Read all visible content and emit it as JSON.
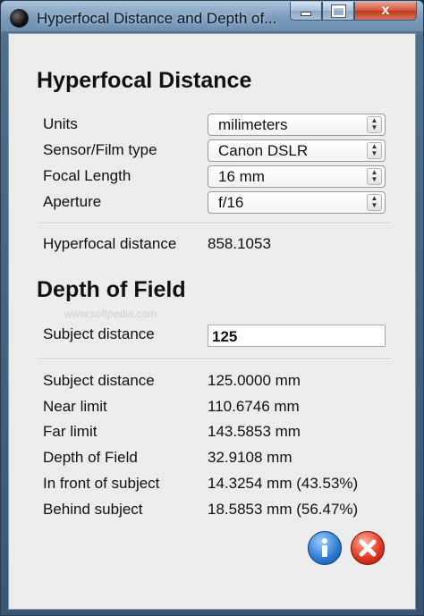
{
  "window": {
    "title": "Hyperfocal Distance and Depth of...",
    "minimize_label": "",
    "maximize_label": "",
    "close_label": "x"
  },
  "hyperfocal": {
    "heading": "Hyperfocal Distance",
    "units": {
      "label": "Units",
      "value": "milimeters"
    },
    "sensor": {
      "label": "Sensor/Film type",
      "value": "Canon DSLR"
    },
    "focal": {
      "label": "Focal Length",
      "value": "16 mm"
    },
    "aperture": {
      "label": "Aperture",
      "value": "f/16"
    },
    "result": {
      "label": "Hyperfocal distance",
      "value": "858.1053"
    }
  },
  "dof": {
    "heading": "Depth of Field",
    "watermark": "www.softpedia.com",
    "subject_input": {
      "label": "Subject distance",
      "value": "125"
    },
    "results": [
      {
        "label": "Subject distance",
        "value": "125.0000 mm"
      },
      {
        "label": "Near limit",
        "value": "110.6746 mm"
      },
      {
        "label": "Far limit",
        "value": "143.5853 mm"
      },
      {
        "label": "Depth of Field",
        "value": "32.9108 mm"
      },
      {
        "label": "In front of subject",
        "value": "14.3254 mm (43.53%)"
      },
      {
        "label": "Behind subject",
        "value": "18.5853 mm (56.47%)"
      }
    ]
  },
  "buttons": {
    "info_icon": "info-icon",
    "close_icon": "close-icon"
  },
  "colors": {
    "info": "#2f7fd6",
    "close": "#e23a24",
    "client_bg": "#ececec"
  }
}
